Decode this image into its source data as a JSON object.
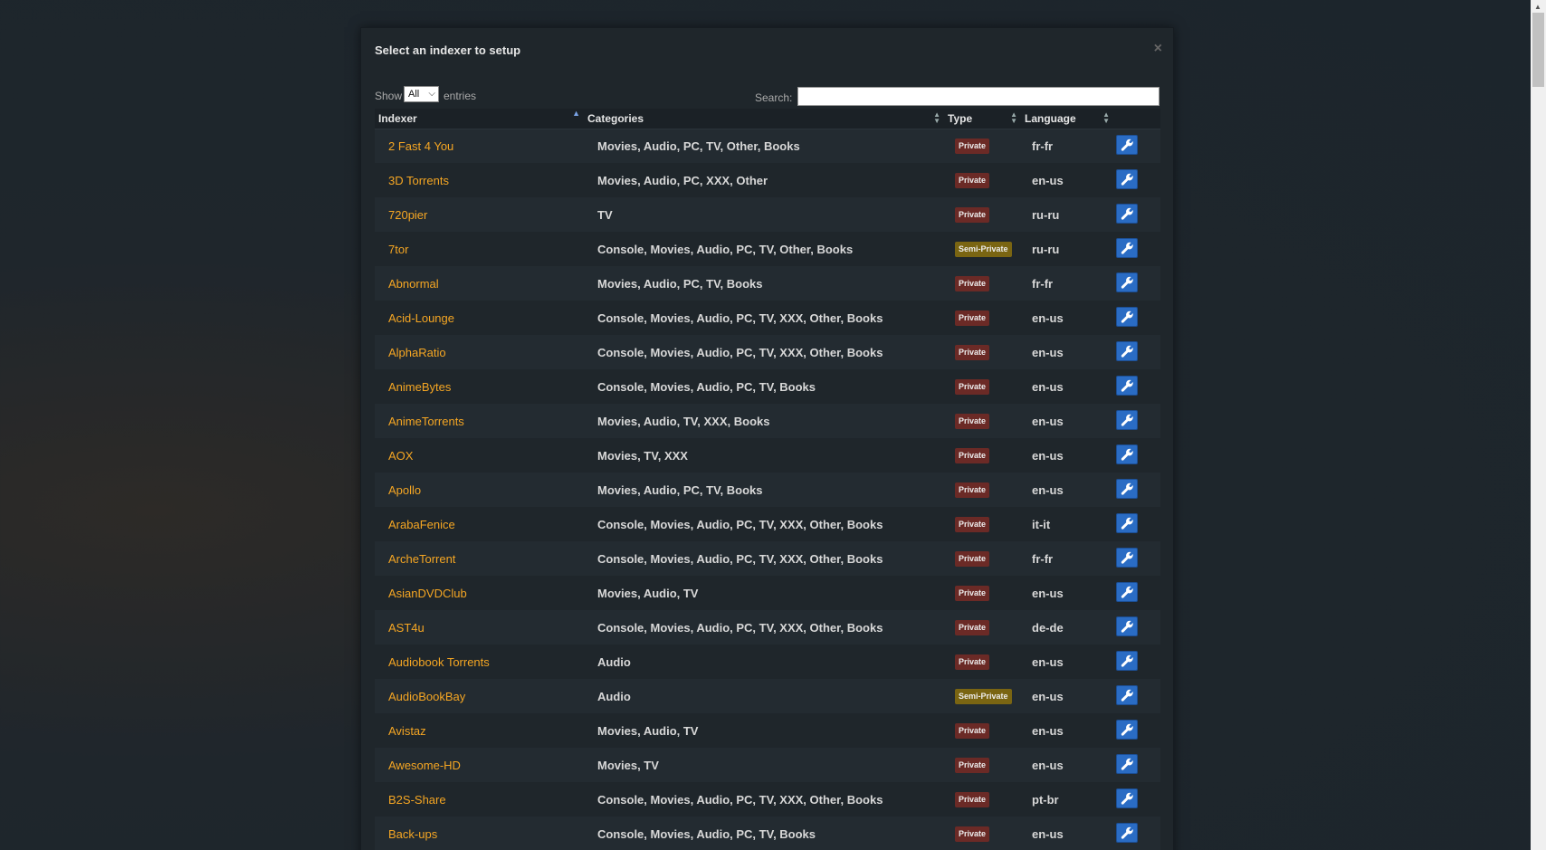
{
  "modal": {
    "title": "Select an indexer to setup",
    "close_glyph": "×"
  },
  "controls": {
    "show_label": "Show",
    "show_value": "All",
    "entries_label": "entries",
    "search_label": "Search:",
    "search_value": ""
  },
  "table": {
    "headers": {
      "indexer": "Indexer",
      "categories": "Categories",
      "type": "Type",
      "language": "Language"
    },
    "sort": {
      "column": "indexer",
      "direction": "asc"
    },
    "rows": [
      {
        "name": "2 Fast 4 You",
        "categories": "Movies, Audio, PC, TV, Other, Books",
        "type": "Private",
        "language": "fr-fr"
      },
      {
        "name": "3D Torrents",
        "categories": "Movies, Audio, PC, XXX, Other",
        "type": "Private",
        "language": "en-us"
      },
      {
        "name": "720pier",
        "categories": "TV",
        "type": "Private",
        "language": "ru-ru"
      },
      {
        "name": "7tor",
        "categories": "Console, Movies, Audio, PC, TV, Other, Books",
        "type": "Semi-Private",
        "language": "ru-ru"
      },
      {
        "name": "Abnormal",
        "categories": "Movies, Audio, PC, TV, Books",
        "type": "Private",
        "language": "fr-fr"
      },
      {
        "name": "Acid-Lounge",
        "categories": "Console, Movies, Audio, PC, TV, XXX, Other, Books",
        "type": "Private",
        "language": "en-us"
      },
      {
        "name": "AlphaRatio",
        "categories": "Console, Movies, Audio, PC, TV, XXX, Other, Books",
        "type": "Private",
        "language": "en-us"
      },
      {
        "name": "AnimeBytes",
        "categories": "Console, Movies, Audio, PC, TV, Books",
        "type": "Private",
        "language": "en-us"
      },
      {
        "name": "AnimeTorrents",
        "categories": "Movies, Audio, TV, XXX, Books",
        "type": "Private",
        "language": "en-us"
      },
      {
        "name": "AOX",
        "categories": "Movies, TV, XXX",
        "type": "Private",
        "language": "en-us"
      },
      {
        "name": "Apollo",
        "categories": "Movies, Audio, PC, TV, Books",
        "type": "Private",
        "language": "en-us"
      },
      {
        "name": "ArabaFenice",
        "categories": "Console, Movies, Audio, PC, TV, XXX, Other, Books",
        "type": "Private",
        "language": "it-it"
      },
      {
        "name": "ArcheTorrent",
        "categories": "Console, Movies, Audio, PC, TV, XXX, Other, Books",
        "type": "Private",
        "language": "fr-fr"
      },
      {
        "name": "AsianDVDClub",
        "categories": "Movies, Audio, TV",
        "type": "Private",
        "language": "en-us"
      },
      {
        "name": "AST4u",
        "categories": "Console, Movies, Audio, PC, TV, XXX, Other, Books",
        "type": "Private",
        "language": "de-de"
      },
      {
        "name": "Audiobook Torrents",
        "categories": "Audio",
        "type": "Private",
        "language": "en-us"
      },
      {
        "name": "AudioBookBay",
        "categories": "Audio",
        "type": "Semi-Private",
        "language": "en-us"
      },
      {
        "name": "Avistaz",
        "categories": "Movies, Audio, TV",
        "type": "Private",
        "language": "en-us"
      },
      {
        "name": "Awesome-HD",
        "categories": "Movies, TV",
        "type": "Private",
        "language": "en-us"
      },
      {
        "name": "B2S-Share",
        "categories": "Console, Movies, Audio, PC, TV, XXX, Other, Books",
        "type": "Private",
        "language": "pt-br"
      },
      {
        "name": "Back-ups",
        "categories": "Console, Movies, Audio, PC, TV, Books",
        "type": "Private",
        "language": "en-us"
      }
    ],
    "action_icon": "wrench-icon"
  },
  "colors": {
    "indexer_link": "#f5a623",
    "private_badge": "#6b2a26",
    "semi_private_badge": "#7a6512",
    "action_button": "#2a6cc4"
  }
}
